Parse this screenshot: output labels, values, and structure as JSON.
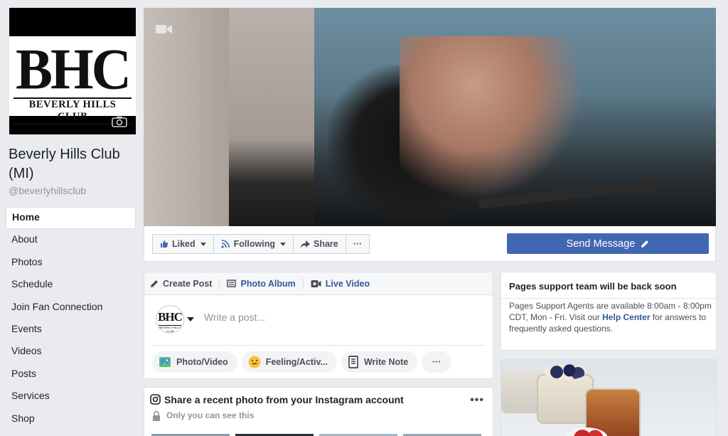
{
  "page": {
    "name": "Beverly Hills Club (MI)",
    "handle": "@beverlyhillsclub"
  },
  "profile": {
    "logo_text": "BHC",
    "logo_subtext": "BEVERLY HILLS CLUB"
  },
  "nav": {
    "items": [
      {
        "label": "Home",
        "active": true
      },
      {
        "label": "About"
      },
      {
        "label": "Photos"
      },
      {
        "label": "Schedule"
      },
      {
        "label": "Join Fan Connection"
      },
      {
        "label": "Events"
      },
      {
        "label": "Videos"
      },
      {
        "label": "Posts"
      },
      {
        "label": "Services"
      },
      {
        "label": "Shop"
      }
    ]
  },
  "actions": {
    "liked": "Liked",
    "following": "Following",
    "share": "Share",
    "more": "···",
    "send_message": "Send Message"
  },
  "composer": {
    "tabs": [
      "Create Post",
      "Photo Album",
      "Live Video"
    ],
    "placeholder": "Write a post...",
    "pills": [
      "Photo/Video",
      "Feeling/Activ...",
      "Write Note"
    ],
    "more": "···"
  },
  "instagram": {
    "title": "Share a recent photo from your Instagram account",
    "subtitle": "Only you can see this",
    "menu": "•••"
  },
  "support": {
    "title": "Pages support team will be back soon",
    "text_before": "Pages Support Agents are available 8:00am - 8:00pm CDT, Mon - Fri. Visit our ",
    "link": "Help Center",
    "text_after": " for answers to frequently asked questions."
  },
  "colors": {
    "brand_blue": "#4267b2",
    "link_blue": "#365899",
    "background": "#e9ebee"
  }
}
